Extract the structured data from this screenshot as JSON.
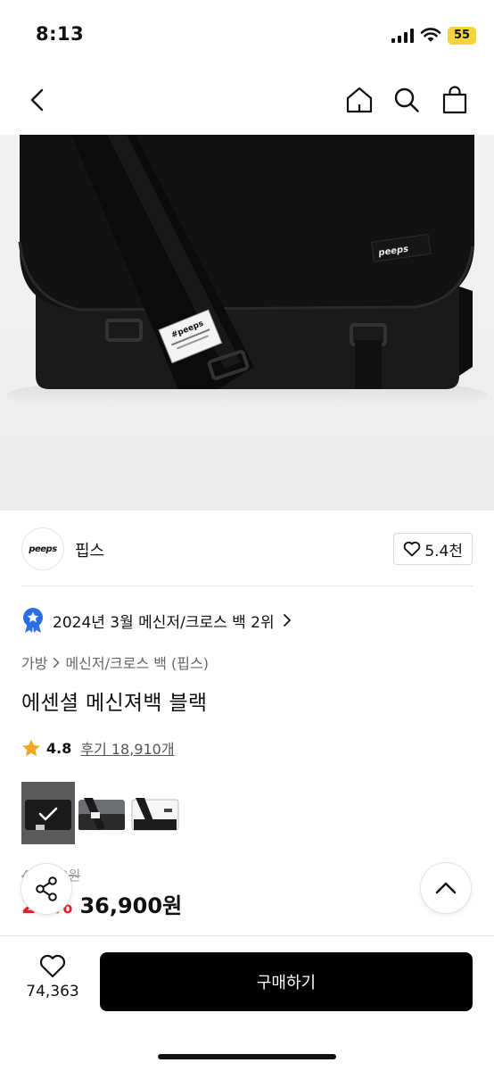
{
  "status_bar": {
    "time": "8:13",
    "battery": "55"
  },
  "brand": {
    "logo_text": "peeps",
    "name": "핍스",
    "likes": "5.4천"
  },
  "ranking": {
    "text": "2024년 3월 메신저/크로스 백 2위"
  },
  "breadcrumb": {
    "items": [
      "가방",
      "메신저/크로스 백 (핍스)"
    ]
  },
  "product": {
    "title": "에센셜 메신져백 블랙",
    "rating": "4.8",
    "review_label": "후기 18,910개",
    "image_brand_tag": "peeps",
    "image_strap_tag": "#peeps"
  },
  "colors": {
    "selected_index": 0,
    "swatches": [
      "black",
      "grey",
      "white"
    ]
  },
  "price": {
    "original": "49,900원",
    "discount": "26%",
    "sale": "36,900원"
  },
  "bottom": {
    "wish_count": "74,363",
    "buy_label": "구매하기"
  },
  "theme": {
    "accent_red": "#e8222a",
    "badge_blue": "#2b6de5",
    "star": "#f5a623"
  },
  "icons": [
    "back-icon",
    "home-icon",
    "search-icon",
    "cart-icon",
    "heart-icon",
    "ranking-badge-icon",
    "chevron-right-icon",
    "star-icon",
    "check-icon",
    "share-icon",
    "chevron-up-icon"
  ]
}
